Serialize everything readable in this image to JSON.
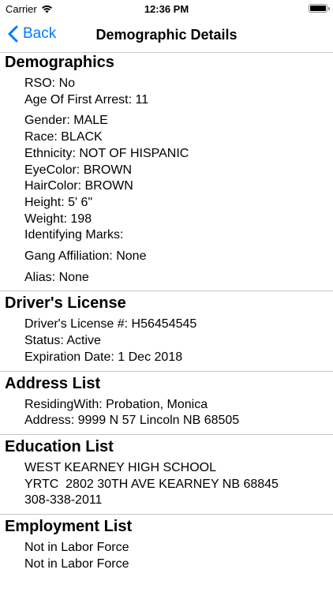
{
  "status_bar": {
    "carrier": "Carrier",
    "time": "12:36 PM"
  },
  "nav": {
    "back_label": "Back",
    "title": "Demographic Details",
    "accent_color": "#007aff"
  },
  "demographics": {
    "header": "Demographics",
    "rso": "RSO: No",
    "age_first_arrest": "Age Of First Arrest: 11",
    "gender": "Gender: MALE",
    "race": "Race: BLACK",
    "ethnicity": "Ethnicity: NOT OF HISPANIC",
    "eye_color": "EyeColor: BROWN",
    "hair_color": "HairColor: BROWN",
    "height": "Height: 5' 6\"",
    "weight": "Weight: 198",
    "identifying_marks": "Identifying Marks:",
    "gang_affiliation": "Gang Affiliation: None",
    "alias": "Alias: None"
  },
  "drivers_license": {
    "header": "Driver's License",
    "number": "Driver's License #: H56454545",
    "status": "Status: Active",
    "expiration": "Expiration Date: 1 Dec 2018"
  },
  "address_list": {
    "header": "Address List",
    "residing_with": "ResidingWith: Probation, Monica",
    "address": "Address: 9999 N 57 Lincoln NB 68505"
  },
  "education_list": {
    "header": "Education List",
    "school": "WEST KEARNEY HIGH SCHOOL",
    "address": "YRTC  2802 30TH AVE KEARNEY NB 68845",
    "phone": "308-338-2011"
  },
  "employment_list": {
    "header": "Employment List",
    "items": [
      "Not in Labor Force",
      "Not in Labor Force"
    ]
  }
}
